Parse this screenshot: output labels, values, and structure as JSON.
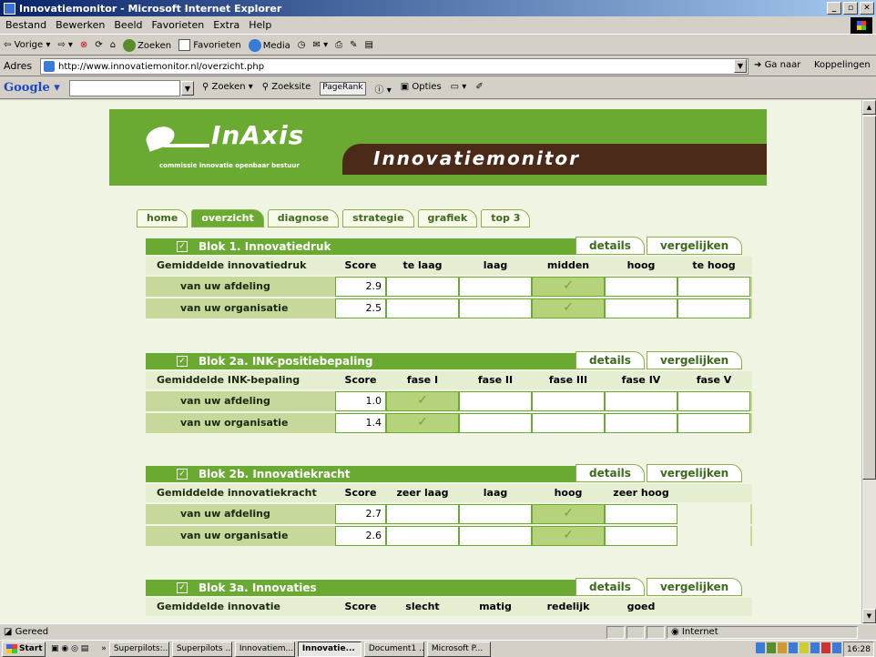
{
  "window": {
    "title": "Innovatiemonitor - Microsoft Internet Explorer"
  },
  "menu": [
    "Bestand",
    "Bewerken",
    "Beeld",
    "Favorieten",
    "Extra",
    "Help"
  ],
  "toolbar": {
    "back": "Vorige",
    "search": "Zoeken",
    "favorites": "Favorieten",
    "media": "Media"
  },
  "address": {
    "label": "Adres",
    "url": "http://www.innovatiemonitor.nl/overzicht.php",
    "go": "Ga naar",
    "links": "Koppelingen"
  },
  "google": {
    "logo": "Google",
    "search": "Zoeken",
    "site": "Zoeksite",
    "pagerank": "PageRank",
    "options": "Opties"
  },
  "header": {
    "brand": "InAxis",
    "tagline": "commissie innovatie openbaar bestuur",
    "app_title": "Innovatiemonitor"
  },
  "nav": [
    "home",
    "overzicht",
    "diagnose",
    "strategie",
    "grafiek",
    "top 3"
  ],
  "tabs": {
    "details": "details",
    "compare": "vergelijken"
  },
  "score_label": "Score",
  "blocks": [
    {
      "title": "Blok 1. Innovatiedruk",
      "label": "Gemiddelde innovatiedruk",
      "cols": [
        "te laag",
        "laag",
        "midden",
        "hoog",
        "te hoog"
      ],
      "rows": [
        {
          "label": "van uw afdeling",
          "score": "2.9",
          "checked": 2
        },
        {
          "label": "van uw organisatie",
          "score": "2.5",
          "checked": 2
        }
      ]
    },
    {
      "title": "Blok 2a. INK-positiebepaling",
      "label": "Gemiddelde INK-bepaling",
      "cols": [
        "fase I",
        "fase II",
        "fase III",
        "fase IV",
        "fase V"
      ],
      "rows": [
        {
          "label": "van uw afdeling",
          "score": "1.0",
          "checked": 0
        },
        {
          "label": "van uw organisatie",
          "score": "1.4",
          "checked": 0
        }
      ]
    },
    {
      "title": "Blok 2b. Innovatiekracht",
      "label": "Gemiddelde innovatiekracht",
      "cols": [
        "zeer laag",
        "laag",
        "hoog",
        "zeer hoog"
      ],
      "rows": [
        {
          "label": "van uw afdeling",
          "score": "2.7",
          "checked": 2
        },
        {
          "label": "van uw organisatie",
          "score": "2.6",
          "checked": 2
        }
      ]
    },
    {
      "title": "Blok 3a. Innovaties",
      "label": "Gemiddelde innovatie",
      "cols": [
        "slecht",
        "matig",
        "redelijk",
        "goed"
      ],
      "rows": []
    }
  ],
  "status": {
    "text": "Gereed",
    "zone": "Internet"
  },
  "taskbar": {
    "start": "Start",
    "items": [
      "Superpilots:...",
      "Superpilots ...",
      "Innovatiem...",
      "Innovatie...",
      "Document1 ...",
      "Microsoft P..."
    ],
    "clock": "16:28"
  }
}
